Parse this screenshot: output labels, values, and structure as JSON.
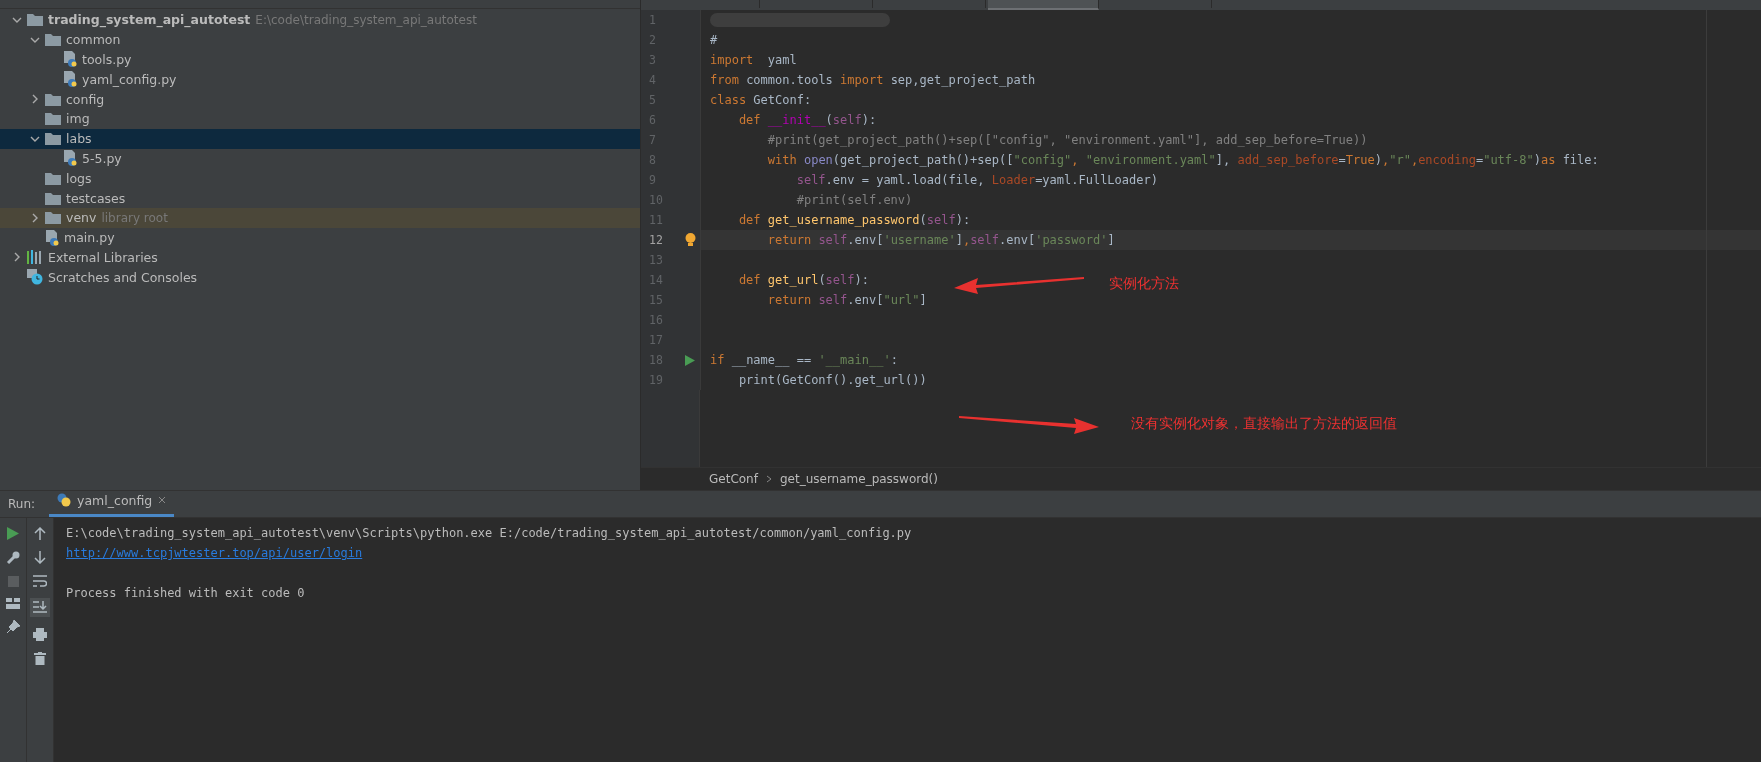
{
  "project_tree": [
    {
      "label": "trading_system_api_autotest",
      "path": "E:\\code\\trading_system_api_autotest",
      "kind": "folder",
      "expanded": true,
      "selected": false,
      "children": [
        {
          "label": "common",
          "kind": "folder",
          "expanded": true,
          "selected": false,
          "children": [
            {
              "label": "tools.py",
              "kind": "python",
              "selected": false
            },
            {
              "label": "yaml_config.py",
              "kind": "python",
              "selected": false
            }
          ]
        },
        {
          "label": "config",
          "kind": "folder",
          "expanded": false,
          "selected": false
        },
        {
          "label": "img",
          "kind": "folder",
          "selected": false
        },
        {
          "label": "labs",
          "kind": "folder",
          "expanded": true,
          "selected": true,
          "children": [
            {
              "label": "5-5.py",
              "kind": "python",
              "selected": false
            }
          ]
        },
        {
          "label": "logs",
          "kind": "folder",
          "selected": false
        },
        {
          "label": "testcases",
          "kind": "folder",
          "selected": false
        },
        {
          "label": "venv",
          "hint": "library root",
          "kind": "library",
          "expanded": false,
          "selected": false
        },
        {
          "label": "main.py",
          "kind": "python",
          "selected": false
        }
      ]
    },
    {
      "label": "External Libraries",
      "kind": "libraries",
      "expanded": false,
      "selected": false
    },
    {
      "label": "Scratches and Consoles",
      "kind": "scratches",
      "selected": false
    }
  ],
  "editor": {
    "tabs": [
      {
        "selected": false
      },
      {
        "selected": false
      },
      {
        "selected": false
      },
      {
        "selected": true
      },
      {
        "selected": false
      }
    ],
    "lines": [
      {
        "number": "1",
        "current": false,
        "redacted": true
      },
      {
        "number": "2",
        "current": false,
        "tokens": [
          {
            "kind": "plain",
            "s": "#"
          }
        ]
      },
      {
        "number": "3",
        "current": false,
        "tokens": [
          {
            "kind": "kw",
            "s": "import"
          },
          {
            "kind": "plain",
            "s": "  yaml"
          }
        ]
      },
      {
        "number": "4",
        "current": false,
        "tokens": [
          {
            "kind": "kw",
            "s": "from"
          },
          {
            "kind": "plain",
            "s": " common.tools "
          },
          {
            "kind": "kw",
            "s": "import"
          },
          {
            "kind": "plain",
            "s": " sep,get_project_path"
          }
        ]
      },
      {
        "number": "5",
        "current": false,
        "tokens": [
          {
            "kind": "kw",
            "s": "class"
          },
          {
            "kind": "plain",
            "s": " GetConf:"
          }
        ]
      },
      {
        "number": "6",
        "current": false,
        "tokens": [
          {
            "kind": "kw",
            "s": "    def"
          },
          {
            "kind": "magic",
            "s": " __init__"
          },
          {
            "kind": "plain",
            "s": "("
          },
          {
            "kind": "self",
            "s": "self"
          },
          {
            "kind": "plain",
            "s": "):"
          }
        ]
      },
      {
        "number": "7",
        "current": false,
        "tokens": [
          {
            "kind": "comment",
            "s": "        #print(get_project_path()+sep([\"config\", \"environment.yaml\"], add_sep_before=True))"
          }
        ]
      },
      {
        "number": "8",
        "current": false,
        "tokens": [
          {
            "kind": "kw",
            "s": "        with"
          },
          {
            "kind": "builtin",
            "s": " open"
          },
          {
            "kind": "plain",
            "s": "(get_project_path()+sep(["
          },
          {
            "kind": "str",
            "s": "\"config\""
          },
          {
            "kind": "kw",
            "s": ","
          },
          {
            "kind": "str",
            "s": " \"environment.yaml\""
          },
          {
            "kind": "plain",
            "s": "],"
          },
          {
            "kind": "param",
            "s": " add_sep_before"
          },
          {
            "kind": "plain",
            "s": "="
          },
          {
            "kind": "kw",
            "s": "True"
          },
          {
            "kind": "plain",
            "s": ")"
          },
          {
            "kind": "kw",
            "s": ","
          },
          {
            "kind": "str",
            "s": "\"r\""
          },
          {
            "kind": "kw",
            "s": ","
          },
          {
            "kind": "param",
            "s": "encoding"
          },
          {
            "kind": "plain",
            "s": "="
          },
          {
            "kind": "str",
            "s": "\"utf-8\""
          },
          {
            "kind": "plain",
            "s": ")"
          },
          {
            "kind": "kw",
            "s": "as"
          },
          {
            "kind": "plain",
            "s": " file:"
          }
        ]
      },
      {
        "number": "9",
        "current": false,
        "tokens": [
          {
            "kind": "self",
            "s": "            self"
          },
          {
            "kind": "plain",
            "s": ".env = yaml.load(file,"
          },
          {
            "kind": "param",
            "s": " Loader"
          },
          {
            "kind": "plain",
            "s": "=yaml.FullLoader)"
          }
        ]
      },
      {
        "number": "10",
        "current": false,
        "tokens": [
          {
            "kind": "comment",
            "s": "            #print(self.env)"
          }
        ]
      },
      {
        "number": "11",
        "current": false,
        "tokens": [
          {
            "kind": "kw",
            "s": "    def"
          },
          {
            "kind": "fn",
            "s": " get_username_password"
          },
          {
            "kind": "plain",
            "s": "("
          },
          {
            "kind": "self",
            "s": "self"
          },
          {
            "kind": "plain",
            "s": "):"
          }
        ]
      },
      {
        "number": "12",
        "current": true,
        "kind": "bulb",
        "tokens": [
          {
            "kind": "kw",
            "s": "        return"
          },
          {
            "kind": "self",
            "s": " self"
          },
          {
            "kind": "plain",
            "s": ".env["
          },
          {
            "kind": "str",
            "s": "'username'"
          },
          {
            "kind": "plain",
            "s": "]"
          },
          {
            "kind": "kw",
            "s": ","
          },
          {
            "kind": "self",
            "s": "self"
          },
          {
            "kind": "plain",
            "s": ".env["
          },
          {
            "kind": "str",
            "s": "'password'"
          },
          {
            "kind": "plain",
            "s": "]"
          }
        ]
      },
      {
        "number": "13",
        "current": false
      },
      {
        "number": "14",
        "current": false,
        "tokens": [
          {
            "kind": "kw",
            "s": "    def"
          },
          {
            "kind": "fn",
            "s": " get_url"
          },
          {
            "kind": "plain",
            "s": "("
          },
          {
            "kind": "self",
            "s": "self"
          },
          {
            "kind": "plain",
            "s": "):"
          }
        ]
      },
      {
        "number": "15",
        "current": false,
        "tokens": [
          {
            "kind": "kw",
            "s": "        return"
          },
          {
            "kind": "self",
            "s": " self"
          },
          {
            "kind": "plain",
            "s": ".env["
          },
          {
            "kind": "str",
            "s": "\"url\""
          },
          {
            "kind": "plain",
            "s": "]"
          }
        ]
      },
      {
        "number": "16",
        "current": false
      },
      {
        "number": "17",
        "current": false
      },
      {
        "number": "18",
        "current": false,
        "kind": "run",
        "tokens": [
          {
            "kind": "kw",
            "s": "if"
          },
          {
            "kind": "plain",
            "s": " __name__ == "
          },
          {
            "kind": "str",
            "s": "'__main__'"
          },
          {
            "kind": "plain",
            "s": ":"
          }
        ]
      },
      {
        "number": "19",
        "current": false,
        "tokens": [
          {
            "kind": "plain",
            "s": "    print(GetConf().get_url())"
          }
        ]
      }
    ],
    "breadcrumbs": [
      "GetConf",
      "get_username_password()"
    ],
    "annotations": [
      {
        "text": "实例化方法",
        "kind": "arrow-left"
      },
      {
        "text": "没有实例化对象，直接输出了方法的返回值",
        "kind": "arrow-right"
      }
    ]
  },
  "run_panel": {
    "label": "Run:",
    "tab": "yaml_config",
    "output": [
      {
        "kind": "text",
        "text": "E:\\code\\trading_system_api_autotest\\venv\\Scripts\\python.exe E:/code/trading_system_api_autotest/common/yaml_config.py",
        "gap_before": false
      },
      {
        "kind": "link",
        "text": "http://www.tcpjwtester.top/api/user/login",
        "gap_before": false
      },
      {
        "kind": "text",
        "text": "Process finished with exit code 0",
        "gap_before": true
      }
    ]
  }
}
